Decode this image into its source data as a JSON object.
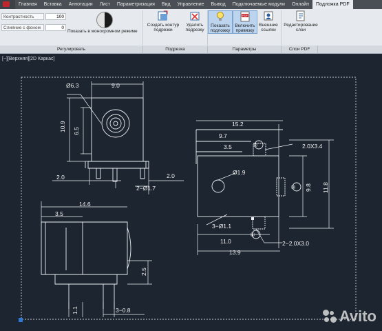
{
  "tabs": [
    "Главная",
    "Вставка",
    "Аннотации",
    "Лист",
    "Параметризация",
    "Вид",
    "Управление",
    "Вывод",
    "Подключаемые модули",
    "Онлайн",
    "Подложка PDF"
  ],
  "ribbon": {
    "contrast_label": "Контрастность",
    "contrast_value": "100",
    "fade_label": "Слияние с фоном",
    "fade_value": "0",
    "mono_button": "Показать в монохромном режиме",
    "snap_outline_button": [
      "Создать контур",
      "подрезки"
    ],
    "remove_snap_button": [
      "Удалить",
      "подрезку"
    ],
    "show_underlay_button": [
      "Показать",
      "подложку"
    ],
    "enable_snap_button": [
      "Включить",
      "привязку"
    ],
    "external_refs_button": [
      "Внешние",
      "ссылки"
    ],
    "edit_layers_button": [
      "Редактирование",
      "слои"
    ],
    "panels": [
      "Регулировать",
      "Подрезка",
      "Параметры",
      "Слои PDF"
    ]
  },
  "viewport": {
    "label": "[−][Верхняя][2D Каркас]"
  },
  "dimensions": {
    "d1": "Ø6.3",
    "d2": "9.0",
    "d3": "10.9",
    "d4": "6.5",
    "d5": "2.0",
    "d6": "2.0",
    "d7": "2−Ø1.7",
    "d8": "15.2",
    "d9": "9.7",
    "d10": "3.5",
    "d11": "2.0X3.4",
    "d12": "Ø1.9",
    "d13": "9.8",
    "d14": "11.8",
    "d15": "14.6",
    "d16": "3.5",
    "d17": "3−Ø1.1",
    "d18": "11.0",
    "d19": "13.9",
    "d20": "2−2.0X3.0",
    "d21": "2.5",
    "d22": "1.1",
    "d23": "3−0.8",
    "c1": "①",
    "c2": "②",
    "c3": "③"
  },
  "watermark": "Avito"
}
